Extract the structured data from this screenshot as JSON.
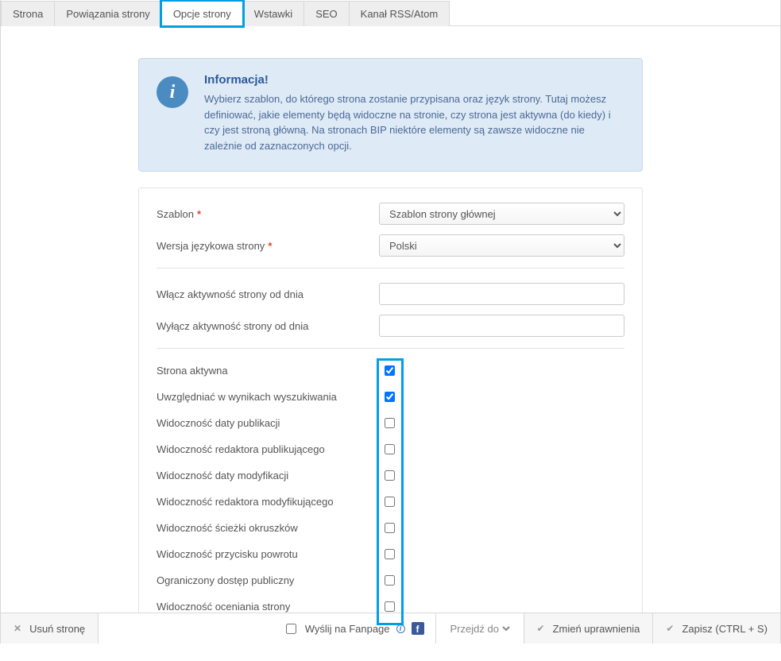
{
  "tabs": {
    "t0": "Strona",
    "t1": "Powiązania strony",
    "t2": "Opcje strony",
    "t3": "Wstawki",
    "t4": "SEO",
    "t5": "Kanał RSS/Atom"
  },
  "info": {
    "title": "Informacja!",
    "text": "Wybierz szablon, do którego strona zostanie przypisana oraz język strony. Tutaj możesz definiować, jakie elementy będą widoczne na stronie, czy strona jest aktywna (do kiedy) i czy jest stroną główną. Na stronach BIP niektóre elementy są zawsze widoczne nie zależnie od zaznaczonych opcji."
  },
  "form": {
    "template_label": "Szablon",
    "template_value": "Szablon strony głównej",
    "lang_label": "Wersja językowa strony",
    "lang_value": "Polski",
    "activate_from_label": "Włącz aktywność strony od dnia",
    "activate_from_value": "",
    "deactivate_from_label": "Wyłącz aktywność strony od dnia",
    "deactivate_from_value": ""
  },
  "checkboxes": {
    "c0": {
      "label": "Strona aktywna",
      "checked": true
    },
    "c1": {
      "label": "Uwzględniać w wynikach wyszukiwania",
      "checked": true
    },
    "c2": {
      "label": "Widoczność daty publikacji",
      "checked": false
    },
    "c3": {
      "label": "Widoczność redaktora publikującego",
      "checked": false
    },
    "c4": {
      "label": "Widoczność daty modyfikacji",
      "checked": false
    },
    "c5": {
      "label": "Widoczność redaktora modyfikującego",
      "checked": false
    },
    "c6": {
      "label": "Widoczność ścieżki okruszków",
      "checked": false
    },
    "c7": {
      "label": "Widoczność przycisku powrotu",
      "checked": false
    },
    "c8": {
      "label": "Ograniczony dostęp publiczny",
      "checked": false
    },
    "c9": {
      "label": "Widoczność oceniania strony",
      "checked": false
    }
  },
  "footer": {
    "delete": "Usuń stronę",
    "fanpage": "Wyślij na Fanpage",
    "goto": "Przejdź do",
    "perms": "Zmień uprawnienia",
    "save": "Zapisz (CTRL + S)"
  }
}
